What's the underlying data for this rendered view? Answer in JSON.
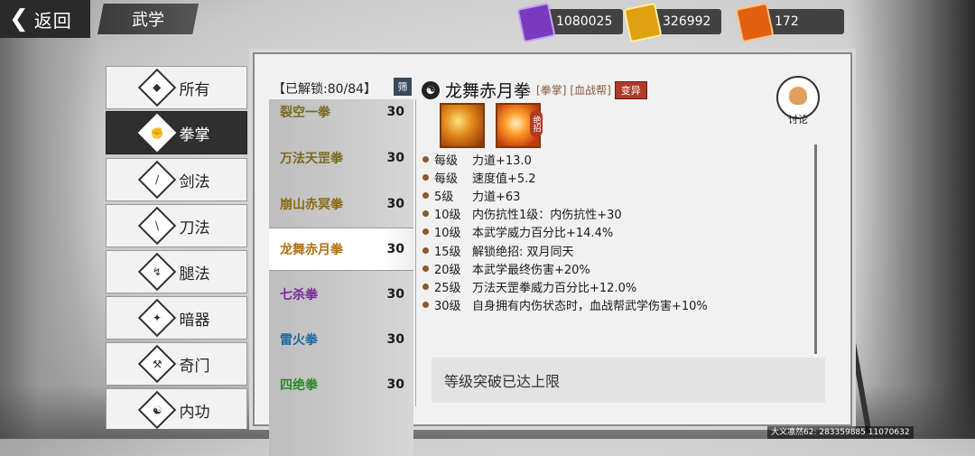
{
  "header": {
    "back_label": "返回",
    "page_title": "武学"
  },
  "resources": [
    {
      "icon": "purple-token-icon",
      "value": "1080025",
      "color": "#7a3ac0"
    },
    {
      "icon": "gold-token-icon",
      "value": "326992",
      "color": "#e0a010"
    },
    {
      "icon": "flame-token-icon",
      "value": "172",
      "color": "#e06010"
    }
  ],
  "categories": [
    {
      "label": "所有",
      "icon": "all-icon"
    },
    {
      "label": "拳掌",
      "icon": "fist-icon",
      "active": true
    },
    {
      "label": "剑法",
      "icon": "sword-icon"
    },
    {
      "label": "刀法",
      "icon": "blade-icon"
    },
    {
      "label": "腿法",
      "icon": "kick-icon"
    },
    {
      "label": "暗器",
      "icon": "hidden-weapon-icon"
    },
    {
      "label": "奇门",
      "icon": "exotic-weapon-icon"
    },
    {
      "label": "内功",
      "icon": "inner-power-icon"
    }
  ],
  "unlock_status": "【已解锁:80/84】",
  "filter_label": "筛",
  "skills": [
    {
      "name": "裂空一拳",
      "level": "30",
      "color": "#7a6a20"
    },
    {
      "name": "万法天罡拳",
      "level": "30",
      "color": "#7a6a20"
    },
    {
      "name": "崩山赤冥拳",
      "level": "30",
      "color": "#8a6a10"
    },
    {
      "name": "龙舞赤月拳",
      "level": "30",
      "color": "#b07010",
      "selected": true
    },
    {
      "name": "七杀拳",
      "level": "30",
      "color": "#7a2a9a"
    },
    {
      "name": "雷火拳",
      "level": "30",
      "color": "#1a6aa0"
    },
    {
      "name": "四绝拳",
      "level": "30",
      "color": "#2a8a2a"
    }
  ],
  "detail": {
    "name": "龙舞赤月拳",
    "type_tag": "[拳掌]",
    "sect_tag": "[血战帮]",
    "mutation_label": "变异",
    "ult_badge": "绝招",
    "effects": [
      {
        "level": "每级",
        "text": "力道+13.0"
      },
      {
        "level": "每级",
        "text": "速度值+5.2"
      },
      {
        "level": "5级",
        "text": "力道+63"
      },
      {
        "level": "10级",
        "text": "内伤抗性1级：内伤抗性+30"
      },
      {
        "level": "10级",
        "text": "本武学威力百分比+14.4%"
      },
      {
        "level": "15级",
        "text": "解锁绝招:   双月同天"
      },
      {
        "level": "20级",
        "text": "本武学最终伤害+20%"
      },
      {
        "level": "25级",
        "text": "万法天罡拳威力百分比+12.0%"
      },
      {
        "level": "30级",
        "text": "自身拥有内伤状态时，血战帮武学伤害+10%"
      }
    ],
    "limit_text": "等级突破已达上限"
  },
  "discuss_label": "讨论",
  "footer_id": "大义凛然62: 283359885  11070632"
}
